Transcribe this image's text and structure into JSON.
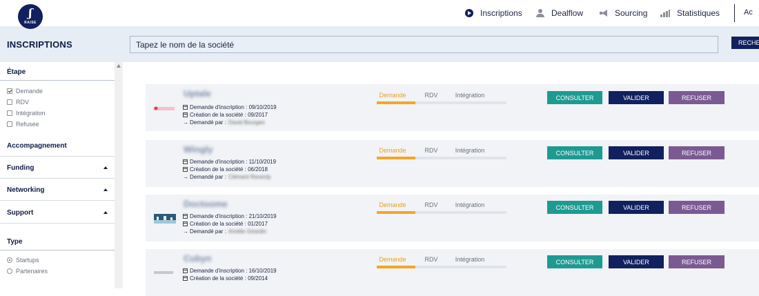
{
  "brand": {
    "logo_mark": "ʃ",
    "logo_text": "RAISE"
  },
  "nav": {
    "items": [
      {
        "label": "Inscriptions",
        "icon": "arrow-circle-icon"
      },
      {
        "label": "Dealflow",
        "icon": "user-icon"
      },
      {
        "label": "Sourcing",
        "icon": "megaphone-icon"
      },
      {
        "label": "Statistiques",
        "icon": "bar-chart-icon"
      }
    ],
    "account_initial": "Ac"
  },
  "page": {
    "title": "INSCRIPTIONS"
  },
  "search": {
    "placeholder": "Tapez le nom de la société",
    "button": "RECHE"
  },
  "sidebar": {
    "etape": {
      "title": "Étape",
      "options": [
        "Demande",
        "RDV",
        "Intégration",
        "Refusée"
      ],
      "checked": "Demande"
    },
    "sections": [
      "Accompagnement",
      "Funding",
      "Networking",
      "Support"
    ],
    "type": {
      "title": "Type",
      "options": [
        "Startups",
        "Partenaires"
      ],
      "selected": "Startups"
    }
  },
  "steps": [
    "Demande",
    "RDV",
    "Intégration"
  ],
  "actions": {
    "consult": "CONSULTER",
    "validate": "VALIDER",
    "refuse": "REFUSER"
  },
  "labels": {
    "demande_inscription": "Demande d'inscription :",
    "creation_societe": "Création de la société :",
    "demande_par": "Demandé par :"
  },
  "requests": [
    {
      "company": "Uptale",
      "demande_date": "09/10/2019",
      "creation_date": "09/2017",
      "requested_by": "David Bourgeo",
      "step": "Demande"
    },
    {
      "company": "Wingly",
      "demande_date": "11/10/2019",
      "creation_date": "06/2018",
      "requested_by": "Clément Reverdy",
      "step": "Demande"
    },
    {
      "company": "Doctoome",
      "demande_date": "21/10/2019",
      "creation_date": "01/2017",
      "requested_by": "Amélie Girardin",
      "step": "Demande"
    },
    {
      "company": "Cubyn",
      "demande_date": "16/10/2019",
      "creation_date": "09/2014",
      "requested_by": "",
      "step": "Demande"
    }
  ],
  "colors": {
    "navy": "#11205e",
    "teal": "#1e9a91",
    "purple": "#7b5a93",
    "orange": "#f5a623",
    "band": "#e6edf5"
  }
}
